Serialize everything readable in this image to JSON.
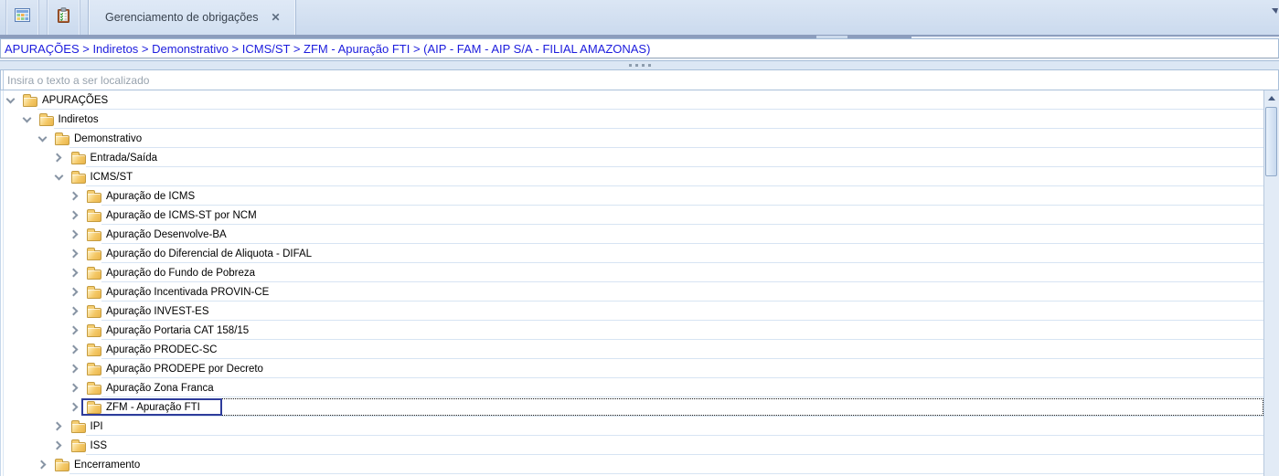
{
  "tab_bar": {
    "icon_tabs": [
      {
        "icon": "grid-icon"
      },
      {
        "icon": "clipboard-check-icon"
      }
    ],
    "active_tab": {
      "label": "Gerenciamento de obrigações",
      "close_glyph": "✕"
    }
  },
  "breadcrumb": {
    "path": "APURAÇÕES > Indiretos > Demonstrativo > ICMS/ST > ZFM - Apuração FTI > (AIP - FAM - AIP S/A - FILIAL AMAZONAS)"
  },
  "search": {
    "placeholder": "Insira o texto a ser localizado",
    "value": ""
  },
  "tree": {
    "items": [
      {
        "label": "APURAÇÕES",
        "level": 0,
        "state": "expanded"
      },
      {
        "label": "Indiretos",
        "level": 1,
        "state": "expanded"
      },
      {
        "label": "Demonstrativo",
        "level": 2,
        "state": "expanded"
      },
      {
        "label": "Entrada/Saída",
        "level": 3,
        "state": "collapsed"
      },
      {
        "label": "ICMS/ST",
        "level": 3,
        "state": "expanded"
      },
      {
        "label": "Apuração de ICMS",
        "level": 4,
        "state": "collapsed"
      },
      {
        "label": "Apuração de ICMS-ST por NCM",
        "level": 4,
        "state": "collapsed"
      },
      {
        "label": "Apuração Desenvolve-BA",
        "level": 4,
        "state": "collapsed"
      },
      {
        "label": "Apuração do Diferencial de Aliquota - DIFAL",
        "level": 4,
        "state": "collapsed"
      },
      {
        "label": "Apuração do Fundo de Pobreza",
        "level": 4,
        "state": "collapsed"
      },
      {
        "label": "Apuração Incentivada PROVIN-CE",
        "level": 4,
        "state": "collapsed"
      },
      {
        "label": "Apuração INVEST-ES",
        "level": 4,
        "state": "collapsed"
      },
      {
        "label": "Apuração Portaria CAT 158/15",
        "level": 4,
        "state": "collapsed"
      },
      {
        "label": "Apuração PRODEC-SC",
        "level": 4,
        "state": "collapsed"
      },
      {
        "label": "Apuração PRODEPE por Decreto",
        "level": 4,
        "state": "collapsed"
      },
      {
        "label": "Apuração Zona Franca",
        "level": 4,
        "state": "collapsed"
      },
      {
        "label": "ZFM - Apuração FTI",
        "level": 4,
        "state": "collapsed",
        "selected": true
      },
      {
        "label": "IPI",
        "level": 3,
        "state": "collapsed"
      },
      {
        "label": "ISS",
        "level": 3,
        "state": "collapsed"
      },
      {
        "label": "Encerramento",
        "level": 2,
        "state": "collapsed"
      }
    ]
  },
  "colors": {
    "selection_border": "#2e3c9b",
    "breadcrumb_text": "#1c1cdd",
    "tab_bar_bg": "#ccdaec",
    "folder_fill": "#f2c45f",
    "row_separator": "#d7e4f3"
  }
}
